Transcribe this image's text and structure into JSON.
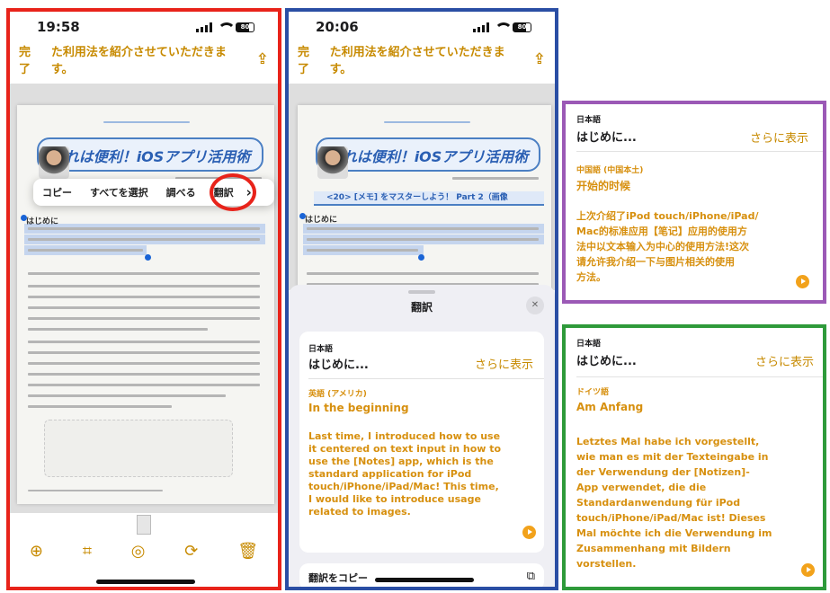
{
  "colors": {
    "accent": "#c78a00",
    "translation": "#d7900f",
    "red": "#e8231a",
    "blue": "#2a4ea4",
    "purple": "#9b59b6",
    "green": "#2e9a3a"
  },
  "phone1": {
    "time": "19:58",
    "battery": "80",
    "done": "完了",
    "nav_text": "た利用法を紹介させていただきます。",
    "banner": "これは便利！iOSアプリ活用術",
    "ctx_menu": [
      "コピー",
      "すべてを選択",
      "調べる",
      "翻訳"
    ],
    "ctx_more": "›",
    "heading": "はじめに",
    "toolbar_icons": [
      "plus-circle-icon",
      "crop-icon",
      "color-filter-icon",
      "rotate-icon",
      "trash-icon"
    ]
  },
  "phone2": {
    "time": "20:06",
    "battery": "80",
    "done": "完了",
    "nav_text": "た利用法を紹介させていただきます。",
    "banner": "これは便利！iOSアプリ活用術",
    "subbanner": "<20> [メモ] をマスターしよう！ Part 2（画像",
    "heading": "はじめに",
    "sheet_title": "翻訳",
    "close": "✕",
    "src_lang": "日本語",
    "src_text": "はじめに...",
    "show_more": "さらに表示",
    "tgt_lang": "英語 (アメリカ)",
    "tgt_title": "In the beginning",
    "tgt_body": [
      "Last time, I introduced how to use",
      "it centered on text input in how to",
      "use the [Notes] app, which is the",
      "standard application for iPod",
      "touch/iPhone/iPad/Mac! This time,",
      "I would like to introduce usage",
      "related to images."
    ],
    "copy_label": "翻訳をコピー"
  },
  "panel_chinese": {
    "src_lang": "日本語",
    "src_text": "はじめに...",
    "show_more": "さらに表示",
    "tgt_lang": "中国語 (中国本土)",
    "tgt_title": "开始的时候",
    "tgt_body": [
      "上次介绍了iPod touch/iPhone/iPad/",
      "Mac的标准应用【笔记】应用的使用方",
      "法中以文本输入为中心的使用方法!这次",
      "请允许我介绍一下与图片相关的使用",
      "方法。"
    ]
  },
  "panel_german": {
    "src_lang": "日本語",
    "src_text": "はじめに...",
    "show_more": "さらに表示",
    "tgt_lang": "ドイツ語",
    "tgt_title": "Am Anfang",
    "tgt_body": [
      "Letztes Mal habe ich vorgestellt,",
      "wie man es mit der Texteingabe in",
      "der Verwendung der [Notizen]-",
      "App verwendet, die die",
      "Standardanwendung für iPod",
      "touch/iPhone/iPad/Mac ist! Dieses",
      "Mal möchte ich die Verwendung im",
      "Zusammenhang mit Bildern",
      "vorstellen."
    ]
  }
}
